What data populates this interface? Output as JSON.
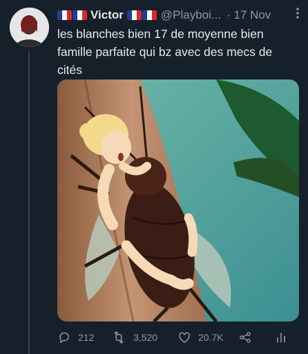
{
  "tweet": {
    "author_name": "Victor",
    "author_handle": "@Playboi...",
    "date": "· 17 Nov",
    "text": "les blanches bien 17 de moyenne bien famille parfaite qui bz avec des mecs de cités",
    "more_icon": "more-vertical-icon",
    "flag_colors": [
      "#1f3f95",
      "#ffffff",
      "#e1262d"
    ],
    "media_alt": "cartoon-illustration"
  },
  "actions": {
    "reply_count": "212",
    "retweet_count": "3,520",
    "like_count": "20.7K",
    "reply_icon": "reply-icon",
    "retweet_icon": "retweet-icon",
    "like_icon": "heart-icon",
    "share_icon": "share-icon",
    "analytics_icon": "analytics-icon"
  },
  "colors": {
    "background": "#15202b",
    "text": "#e7e9ea",
    "muted": "#8b98a5"
  }
}
